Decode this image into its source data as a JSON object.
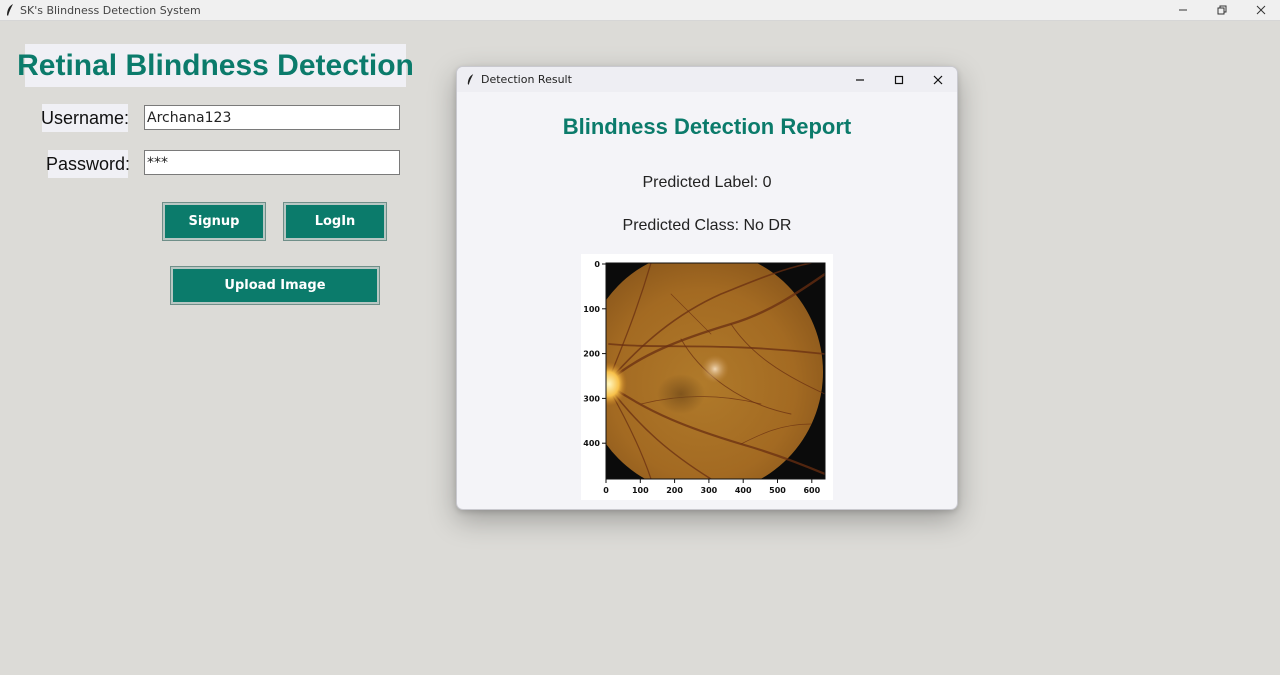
{
  "window": {
    "title": "SK's Blindness Detection System",
    "icon": "feather-icon"
  },
  "main": {
    "heading": "Retinal Blindness Detection",
    "username_label": "Username:",
    "username_value": "Archana123",
    "password_label": "Password:",
    "password_value": "***",
    "signup_label": "Signup",
    "login_label": "LogIn",
    "upload_label": "Upload Image"
  },
  "dialog": {
    "title": "Detection Result",
    "report_title": "Blindness Detection Report",
    "predicted_label": "Predicted Label: 0",
    "predicted_class": "Predicted Class: No DR",
    "plot": {
      "x_ticks": [
        "0",
        "100",
        "200",
        "300",
        "400",
        "500",
        "600"
      ],
      "y_ticks": [
        "0",
        "100",
        "200",
        "300",
        "400"
      ]
    }
  },
  "colors": {
    "accent": "#0b7b6b",
    "background": "#dcdbd7",
    "label_bg": "#f0f0f5"
  }
}
